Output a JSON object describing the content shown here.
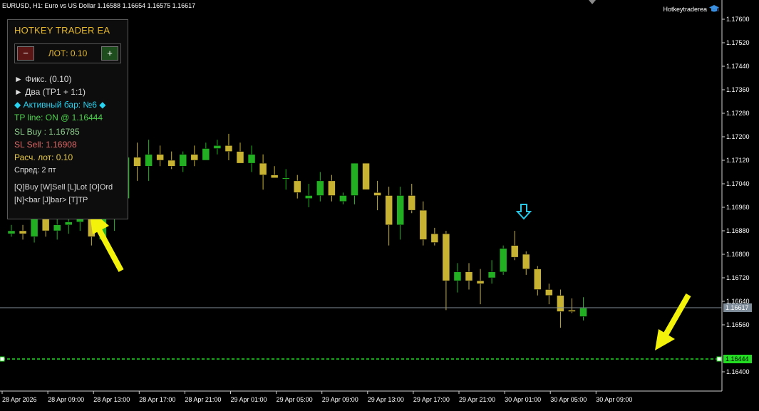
{
  "window": {
    "symbol_info": "EURUSD, H1:  Euro vs US Dollar  1.16588 1.16654 1.16575 1.16617",
    "branding": "Hotkeytraderea"
  },
  "colors": {
    "background": "#000000",
    "bull_candle": "#22b022",
    "bear_candle": "#c8b232",
    "tp_line": "#22dd22",
    "current_price_line": "#7f8c99",
    "arrow_annotation": "#f2f20a",
    "signal_arrow": "#27c8e8",
    "panel_title": "#e6b92c"
  },
  "ea_panel": {
    "title": "HOTKEY TRADER EA",
    "lot_minus": "−",
    "lot_label": "ЛОТ: 0.10",
    "lot_plus": "+",
    "mode_fixed": "► Фикс. (0.10)",
    "mode_two": "► Два (TP1 + 1:1)",
    "active_bar": "◆ Активный бар: №6 ◆",
    "tp_line": "TP line: ON @ 1.16444",
    "sl_buy": "SL Buy : 1.16785",
    "sl_sell": "SL Sell: 1.16908",
    "calc_lot": "Расч. лот: 0.10",
    "spread": "Спред: 2 пт",
    "hotkeys_row1": "[Q]Buy  [W]Sell  [L]Lot  [O]Ord",
    "hotkeys_row2": "[N]<bar  [J]bar>  [T]TP"
  },
  "price_axis": {
    "labels": [
      "1.17600",
      "1.17520",
      "1.17440",
      "1.17360",
      "1.17280",
      "1.17200",
      "1.17120",
      "1.17040",
      "1.16960",
      "1.16880",
      "1.16800",
      "1.16720",
      "1.16640",
      "1.16560",
      "1.16400"
    ],
    "current_price": "1.16617",
    "tp_price": "1.16444"
  },
  "time_axis": {
    "labels": [
      "28 Apr 2026",
      "28 Apr 09:00",
      "28 Apr 13:00",
      "28 Apr 17:00",
      "28 Apr 21:00",
      "29 Apr 01:00",
      "29 Apr 05:00",
      "29 Apr 09:00",
      "29 Apr 13:00",
      "29 Apr 17:00",
      "29 Apr 21:00",
      "30 Apr 01:00",
      "30 Apr 05:00",
      "30 Apr 09:00"
    ]
  },
  "chart_data": {
    "type": "candlestick",
    "symbol": "EURUSD",
    "timeframe": "H1",
    "ylim": [
      1.1636,
      1.1765
    ],
    "current_price": 1.16617,
    "tp_line": 1.16444,
    "candles": [
      {
        "o": 1.1687,
        "h": 1.169,
        "l": 1.1686,
        "c": 1.1688
      },
      {
        "o": 1.1688,
        "h": 1.169,
        "l": 1.1685,
        "c": 1.1687
      },
      {
        "o": 1.1686,
        "h": 1.1695,
        "l": 1.1684,
        "c": 1.1692
      },
      {
        "o": 1.1692,
        "h": 1.1695,
        "l": 1.1686,
        "c": 1.1688
      },
      {
        "o": 1.1688,
        "h": 1.1692,
        "l": 1.1685,
        "c": 1.169
      },
      {
        "o": 1.169,
        "h": 1.1695,
        "l": 1.1687,
        "c": 1.1691
      },
      {
        "o": 1.1691,
        "h": 1.1698,
        "l": 1.1688,
        "c": 1.1692
      },
      {
        "o": 1.1692,
        "h": 1.1693,
        "l": 1.1683,
        "c": 1.1686
      },
      {
        "o": 1.1685,
        "h": 1.1695,
        "l": 1.1684,
        "c": 1.1694
      },
      {
        "o": 1.1694,
        "h": 1.16985,
        "l": 1.1688,
        "c": 1.1698
      },
      {
        "o": 1.1699,
        "h": 1.1717,
        "l": 1.1698,
        "c": 1.1713
      },
      {
        "o": 1.1713,
        "h": 1.1718,
        "l": 1.1705,
        "c": 1.171
      },
      {
        "o": 1.171,
        "h": 1.1719,
        "l": 1.1705,
        "c": 1.1714
      },
      {
        "o": 1.1714,
        "h": 1.1717,
        "l": 1.171,
        "c": 1.1712
      },
      {
        "o": 1.1712,
        "h": 1.1715,
        "l": 1.1709,
        "c": 1.171
      },
      {
        "o": 1.171,
        "h": 1.1715,
        "l": 1.1708,
        "c": 1.1714
      },
      {
        "o": 1.1714,
        "h": 1.1717,
        "l": 1.171,
        "c": 1.1712
      },
      {
        "o": 1.1712,
        "h": 1.1718,
        "l": 1.1712,
        "c": 1.1716
      },
      {
        "o": 1.1716,
        "h": 1.1719,
        "l": 1.1714,
        "c": 1.1717
      },
      {
        "o": 1.1717,
        "h": 1.1721,
        "l": 1.1712,
        "c": 1.1715
      },
      {
        "o": 1.1715,
        "h": 1.1718,
        "l": 1.1711,
        "c": 1.1711
      },
      {
        "o": 1.1711,
        "h": 1.1717,
        "l": 1.1708,
        "c": 1.1714
      },
      {
        "o": 1.1711,
        "h": 1.1714,
        "l": 1.1702,
        "c": 1.1707
      },
      {
        "o": 1.1707,
        "h": 1.171,
        "l": 1.1706,
        "c": 1.1706
      },
      {
        "o": 1.1706,
        "h": 1.1709,
        "l": 1.1702,
        "c": 1.1706
      },
      {
        "o": 1.1705,
        "h": 1.1707,
        "l": 1.1699,
        "c": 1.1701
      },
      {
        "o": 1.1699,
        "h": 1.1704,
        "l": 1.1696,
        "c": 1.17
      },
      {
        "o": 1.17,
        "h": 1.1708,
        "l": 1.1698,
        "c": 1.1705
      },
      {
        "o": 1.1705,
        "h": 1.1707,
        "l": 1.1698,
        "c": 1.17
      },
      {
        "o": 1.1698,
        "h": 1.1701,
        "l": 1.1697,
        "c": 1.17
      },
      {
        "o": 1.17,
        "h": 1.1711,
        "l": 1.1697,
        "c": 1.1711
      },
      {
        "o": 1.1711,
        "h": 1.1711,
        "l": 1.1702,
        "c": 1.1702
      },
      {
        "o": 1.1701,
        "h": 1.1705,
        "l": 1.1695,
        "c": 1.17
      },
      {
        "o": 1.17,
        "h": 1.1703,
        "l": 1.1683,
        "c": 1.169
      },
      {
        "o": 1.169,
        "h": 1.1703,
        "l": 1.1685,
        "c": 1.17
      },
      {
        "o": 1.17,
        "h": 1.1704,
        "l": 1.1694,
        "c": 1.1695
      },
      {
        "o": 1.1695,
        "h": 1.1698,
        "l": 1.1683,
        "c": 1.1685
      },
      {
        "o": 1.1687,
        "h": 1.1689,
        "l": 1.1683,
        "c": 1.1684
      },
      {
        "o": 1.1687,
        "h": 1.1688,
        "l": 1.1661,
        "c": 1.1671
      },
      {
        "o": 1.1671,
        "h": 1.1677,
        "l": 1.1667,
        "c": 1.1674
      },
      {
        "o": 1.1674,
        "h": 1.1677,
        "l": 1.1668,
        "c": 1.1671
      },
      {
        "o": 1.1671,
        "h": 1.1675,
        "l": 1.1663,
        "c": 1.167
      },
      {
        "o": 1.1672,
        "h": 1.1678,
        "l": 1.167,
        "c": 1.1674
      },
      {
        "o": 1.1674,
        "h": 1.1683,
        "l": 1.1673,
        "c": 1.1682
      },
      {
        "o": 1.1683,
        "h": 1.1688,
        "l": 1.1678,
        "c": 1.1679
      },
      {
        "o": 1.168,
        "h": 1.1681,
        "l": 1.1673,
        "c": 1.1675
      },
      {
        "o": 1.1675,
        "h": 1.1676,
        "l": 1.1666,
        "c": 1.1668
      },
      {
        "o": 1.1668,
        "h": 1.167,
        "l": 1.1663,
        "c": 1.1666
      },
      {
        "o": 1.1666,
        "h": 1.1668,
        "l": 1.1655,
        "c": 1.16605
      },
      {
        "o": 1.1661,
        "h": 1.1665,
        "l": 1.166,
        "c": 1.16605
      },
      {
        "o": 1.16588,
        "h": 1.16654,
        "l": 1.16575,
        "c": 1.16617
      }
    ]
  }
}
